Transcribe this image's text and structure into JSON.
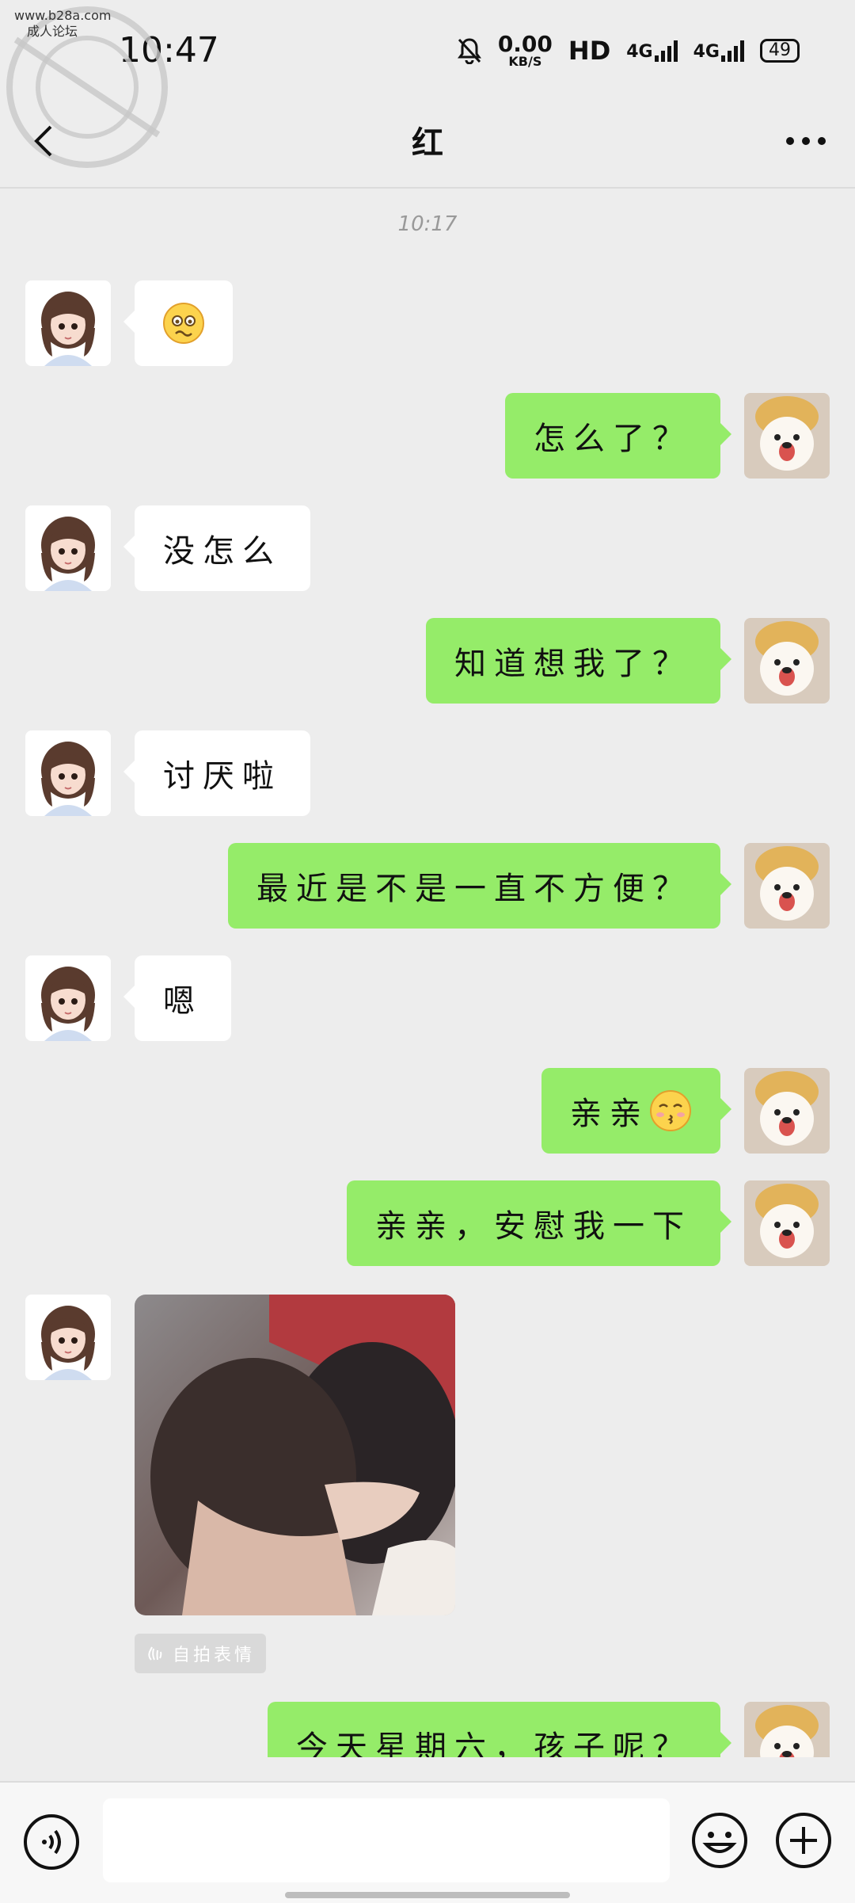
{
  "watermark": {
    "site": "www.b28a.com",
    "title": "成人论坛"
  },
  "status_bar": {
    "time": "10:47",
    "speed_value": "0.00",
    "speed_unit": "KB/S",
    "hd": "HD",
    "network1": "4G",
    "network2": "4G",
    "battery": "49"
  },
  "header": {
    "title": "红"
  },
  "timestamp": "10:17",
  "messages": [
    {
      "side": "left",
      "text": "",
      "emoji": "woozy-face"
    },
    {
      "side": "right",
      "text": "怎么了？"
    },
    {
      "side": "left",
      "text": "没怎么"
    },
    {
      "side": "right",
      "text": "知道想我了？"
    },
    {
      "side": "left",
      "text": "讨厌啦"
    },
    {
      "side": "right",
      "text": "最近是不是一直不方便？"
    },
    {
      "side": "left",
      "text": "嗯"
    },
    {
      "side": "right",
      "text": "亲亲",
      "emoji": "kissing-face"
    },
    {
      "side": "right",
      "text": "亲亲，安慰我一下"
    },
    {
      "side": "left",
      "type": "image",
      "tag": "自拍表情"
    },
    {
      "side": "right",
      "text": "今天星期六，孩子呢？"
    }
  ],
  "colors": {
    "background": "#ededed",
    "self_bubble": "#95ec69",
    "other_bubble": "#ffffff"
  }
}
